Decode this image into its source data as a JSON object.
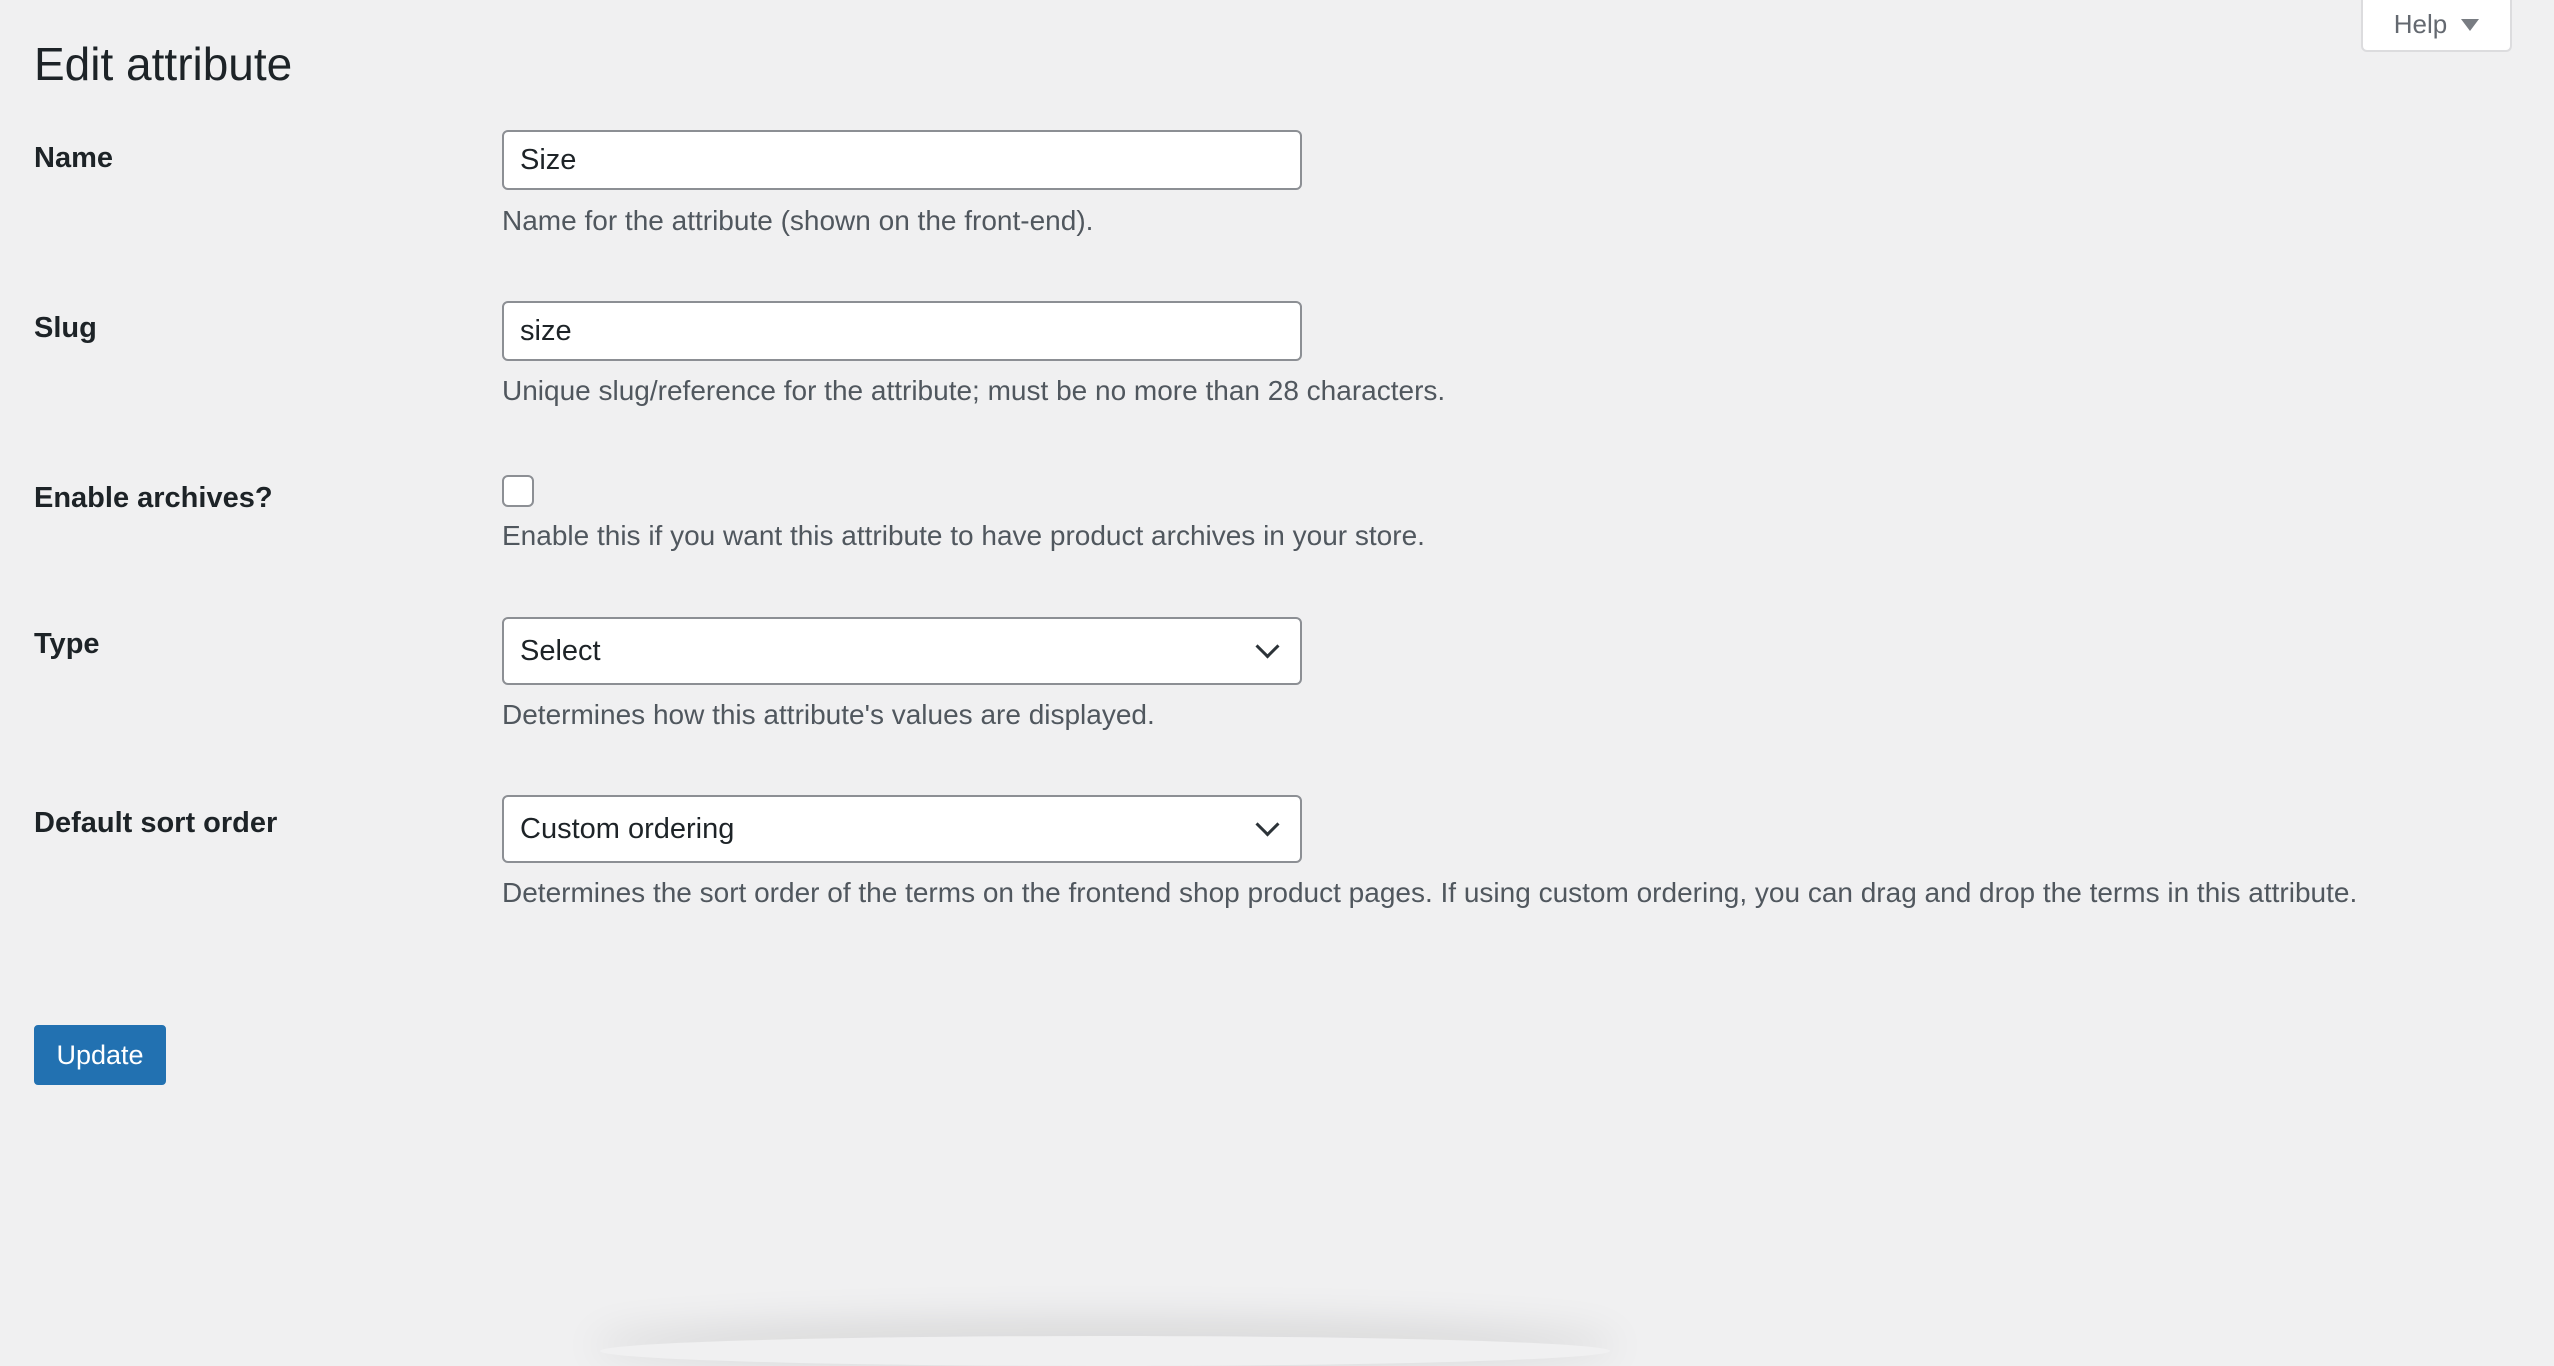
{
  "help": {
    "label": "Help"
  },
  "page": {
    "title": "Edit attribute"
  },
  "fields": {
    "name": {
      "label": "Name",
      "value": "Size",
      "description": "Name for the attribute (shown on the front-end)."
    },
    "slug": {
      "label": "Slug",
      "value": "size",
      "description": "Unique slug/reference for the attribute; must be no more than 28 characters."
    },
    "archives": {
      "label": "Enable archives?",
      "checked": false,
      "description": "Enable this if you want this attribute to have product archives in your store."
    },
    "type": {
      "label": "Type",
      "selected": "Select",
      "description": "Determines how this attribute's values are displayed."
    },
    "sort_order": {
      "label": "Default sort order",
      "selected": "Custom ordering",
      "description": "Determines the sort order of the terms on the frontend shop product pages. If using custom ordering, you can drag and drop the terms in this attribute."
    }
  },
  "actions": {
    "update_label": "Update"
  },
  "colors": {
    "background": "#f0f0f1",
    "primary_button": "#2271b1",
    "input_border": "#8c8f94",
    "description_text": "#50575e"
  },
  "icons": {
    "help_toggle": "triangle-down-icon",
    "select_toggle": "chevron-down-icon"
  }
}
